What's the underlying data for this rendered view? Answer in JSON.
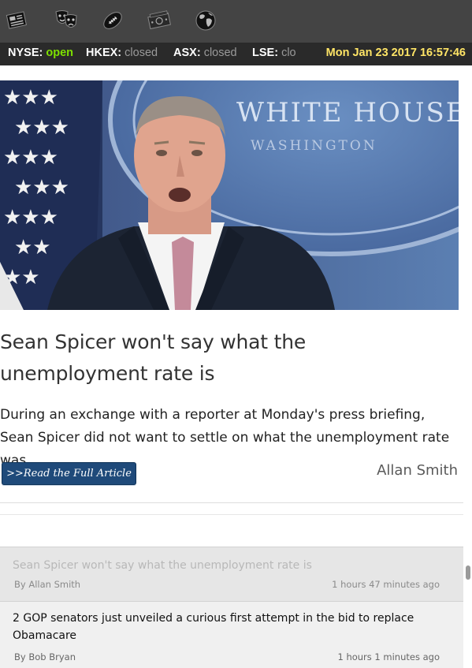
{
  "nav_icons": [
    "newspaper-icon",
    "theater-masks-icon",
    "football-icon",
    "money-icon",
    "globe-icon"
  ],
  "ticker": {
    "markets": [
      {
        "exchange": "NYSE:",
        "status": "open"
      },
      {
        "exchange": "HKEX:",
        "status": "closed"
      },
      {
        "exchange": "ASX:",
        "status": "closed"
      },
      {
        "exchange": "LSE:",
        "status": "clo"
      }
    ],
    "clock": "Mon Jan 23 2017 16:57:46",
    "colors": {
      "open": "#7ee000",
      "closed": "#9a9a9a",
      "clock": "#ffe566"
    }
  },
  "article": {
    "headline": "Sean Spicer won't say what the unemployment rate is",
    "summary": "During an exchange with a reporter at Monday's press briefing, Sean Spicer did not want to settle on what the unemployment rate was.",
    "read_more": ">>Read the Full Article",
    "author": "Allan Smith",
    "image_text": {
      "line1": "WHITE HOUSE",
      "line2": "WASHINGTON"
    }
  },
  "list": [
    {
      "title": "Sean Spicer won't say what the unemployment rate is",
      "byline": "By Allan Smith",
      "ago": "1 hours 47 minutes ago",
      "active": true
    },
    {
      "title": "2 GOP senators just unveiled a curious first attempt in the bid to replace Obamacare",
      "byline": "By Bob Bryan",
      "ago": "1 hours 1 minutes ago",
      "active": false
    }
  ]
}
